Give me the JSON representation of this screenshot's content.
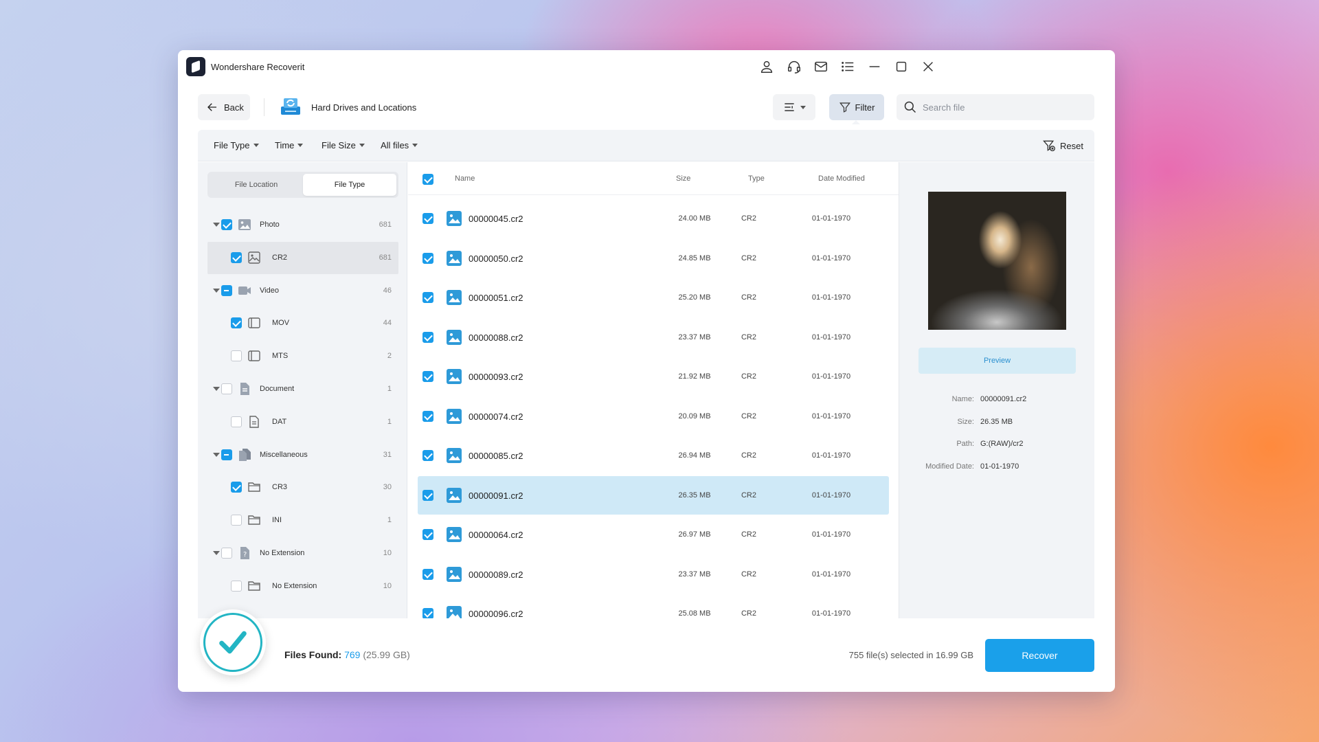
{
  "app": {
    "title": "Wondershare Recoverit",
    "icons": [
      "user-icon",
      "headset-icon",
      "mail-icon",
      "menu-list-icon",
      "minimize-icon",
      "maximize-icon",
      "close-icon"
    ]
  },
  "header": {
    "back_label": "Back",
    "location_title": "Hard Drives and Locations",
    "filter_label": "Filter",
    "search_placeholder": "Search file"
  },
  "filter_bar": {
    "items": [
      "File Type",
      "Time",
      "File Size",
      "All files"
    ],
    "reset_label": "Reset"
  },
  "left_panel": {
    "tabs": [
      "File Location",
      "File Type"
    ],
    "active_tab": "File Type",
    "tree": [
      {
        "label": "Photo",
        "count": "681",
        "level": 0,
        "state": "checked",
        "icon": "photo-icon"
      },
      {
        "label": "CR2",
        "count": "681",
        "level": 1,
        "state": "checked",
        "icon": "image-icon"
      },
      {
        "label": "Video",
        "count": "46",
        "level": 0,
        "state": "partial",
        "icon": "video-icon"
      },
      {
        "label": "MOV",
        "count": "44",
        "level": 1,
        "state": "checked",
        "icon": "film-icon"
      },
      {
        "label": "MTS",
        "count": "2",
        "level": 1,
        "state": "unchecked",
        "icon": "film-icon"
      },
      {
        "label": "Document",
        "count": "1",
        "level": 0,
        "state": "unchecked",
        "icon": "document-icon"
      },
      {
        "label": "DAT",
        "count": "1",
        "level": 1,
        "state": "unchecked",
        "icon": "file-icon"
      },
      {
        "label": "Miscellaneous",
        "count": "31",
        "level": 0,
        "state": "partial",
        "icon": "misc-icon"
      },
      {
        "label": "CR3",
        "count": "30",
        "level": 1,
        "state": "checked",
        "icon": "folder-icon"
      },
      {
        "label": "INI",
        "count": "1",
        "level": 1,
        "state": "unchecked",
        "icon": "folder-icon"
      },
      {
        "label": "No Extension",
        "count": "10",
        "level": 0,
        "state": "unchecked",
        "icon": "unknown-file-icon"
      },
      {
        "label": "No Extension",
        "count": "10",
        "level": 1,
        "state": "unchecked",
        "icon": "folder-icon"
      }
    ]
  },
  "file_list": {
    "columns": [
      "Name",
      "Size",
      "Type",
      "Date Modified"
    ],
    "rows": [
      {
        "name": "00000045.cr2",
        "size": "24.00 MB",
        "type": "CR2",
        "date": "01-01-1970"
      },
      {
        "name": "00000050.cr2",
        "size": "24.85 MB",
        "type": "CR2",
        "date": "01-01-1970"
      },
      {
        "name": "00000051.cr2",
        "size": "25.20 MB",
        "type": "CR2",
        "date": "01-01-1970"
      },
      {
        "name": "00000088.cr2",
        "size": "23.37 MB",
        "type": "CR2",
        "date": "01-01-1970"
      },
      {
        "name": "00000093.cr2",
        "size": "21.92 MB",
        "type": "CR2",
        "date": "01-01-1970"
      },
      {
        "name": "00000074.cr2",
        "size": "20.09 MB",
        "type": "CR2",
        "date": "01-01-1970"
      },
      {
        "name": "00000085.cr2",
        "size": "26.94 MB",
        "type": "CR2",
        "date": "01-01-1970"
      },
      {
        "name": "00000091.cr2",
        "size": "26.35 MB",
        "type": "CR2",
        "date": "01-01-1970",
        "selected": true
      },
      {
        "name": "00000064.cr2",
        "size": "26.97 MB",
        "type": "CR2",
        "date": "01-01-1970"
      },
      {
        "name": "00000089.cr2",
        "size": "23.37 MB",
        "type": "CR2",
        "date": "01-01-1970"
      },
      {
        "name": "00000096.cr2",
        "size": "25.08 MB",
        "type": "CR2",
        "date": "01-01-1970"
      }
    ]
  },
  "preview": {
    "button_label": "Preview",
    "meta": [
      {
        "key": "Name:",
        "value": "00000091.cr2"
      },
      {
        "key": "Size:",
        "value": "26.35 MB"
      },
      {
        "key": "Path:",
        "value": "G:(RAW)/cr2"
      },
      {
        "key": "Modified Date:",
        "value": "01-01-1970"
      }
    ]
  },
  "footer": {
    "files_found_label": "Files Found:",
    "files_found_count": "769",
    "files_found_size": "(25.99 GB)",
    "selected_text": "755 file(s) selected in 16.99 GB",
    "recover_label": "Recover"
  },
  "colors": {
    "accent": "#1aa0ea",
    "selected_row": "#cfe9f7",
    "panel_bg": "#f2f4f7"
  }
}
